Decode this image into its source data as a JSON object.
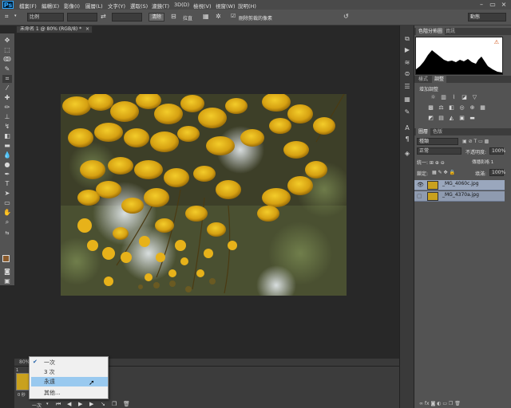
{
  "app": {
    "logo": "Ps"
  },
  "menu": [
    "檔案(F)",
    "編輯(E)",
    "影像(I)",
    "圖層(L)",
    "文字(Y)",
    "選取(S)",
    "濾鏡(T)",
    "3D(D)",
    "檢視(V)",
    "視窗(W)",
    "說明(H)"
  ],
  "window_controls": [
    "–",
    "▭",
    "×"
  ],
  "options": {
    "style_value": "比例",
    "clear_label": "清除",
    "straighten_label": "拉直",
    "delete_cropped_label": "刪除剪裁的像素",
    "workspace": "動態"
  },
  "document": {
    "tab_title": "未命名 1 @ 80% (RGB/8) *",
    "close": "×"
  },
  "timeline": {
    "loop_options": [
      "一次",
      "3 次",
      "永遠",
      "其他..."
    ],
    "selected_loop": "永遠",
    "footer_loop": "一次",
    "frame_number": "1",
    "frame_duration": "0 秒"
  },
  "panels": {
    "top_tabs": [
      "色階分佈圖",
      "資訊"
    ],
    "mid_tabs": [
      "樣式",
      "調整"
    ],
    "adjust_title": "增加調整",
    "layer_tabs": [
      "圖層",
      "色版"
    ],
    "kind_label": "種類",
    "blend_mode": "正常",
    "opacity_label": "不透明度:",
    "opacity_value": "100%",
    "lock_label": "鎖定:",
    "fill_label": "填滿:",
    "fill_value": "100%",
    "unify_label": "傳播影格 1",
    "layers": [
      "_MG_4060c.jpg",
      "_MG_4370a.jpg"
    ]
  },
  "colors": {
    "accent": "#31a8ff",
    "selection": "#99c9ef",
    "layer_highlight": "#9aa7bd"
  }
}
